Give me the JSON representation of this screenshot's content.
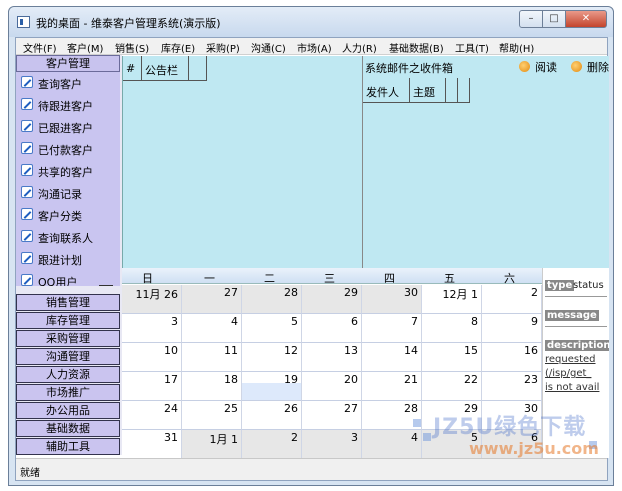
{
  "window": {
    "title": "我的桌面 - 维泰客户管理系统(演示版)"
  },
  "menu": [
    "文件(F)",
    "客户(M)",
    "销售(S)",
    "库存(E)",
    "采购(P)",
    "沟通(C)",
    "市场(A)",
    "人力(R)",
    "基础数据(B)",
    "工具(T)",
    "帮助(H)"
  ],
  "nav": {
    "header": "客户管理",
    "items": [
      "查询客户",
      "待跟进客户",
      "已跟进客户",
      "已付款客户",
      "共享的客户",
      "沟通记录",
      "客户分类",
      "查询联系人",
      "跟进计划",
      "QQ用户"
    ],
    "categories": [
      "销售管理",
      "库存管理",
      "采购管理",
      "沟通管理",
      "人力资源",
      "市场推广",
      "办公用品",
      "基础数据",
      "辅助工具"
    ]
  },
  "notice": {
    "col_hash": "#",
    "col_title": "公告栏"
  },
  "mail": {
    "title": "系统邮件之收件箱",
    "read": "阅读",
    "delete": "删除",
    "col_sender": "发件人",
    "col_subject": "主题"
  },
  "calendar": {
    "weekdays": [
      "日",
      "一",
      "二",
      "三",
      "四",
      "五",
      "六"
    ],
    "weeks": [
      [
        "11月 26",
        "27",
        "28",
        "29",
        "30",
        "12月 1",
        "2"
      ],
      [
        "3",
        "4",
        "5",
        "6",
        "7",
        "8",
        "9"
      ],
      [
        "10",
        "11",
        "12",
        "13",
        "14",
        "15",
        "16"
      ],
      [
        "17",
        "18",
        "19",
        "20",
        "21",
        "22",
        "23"
      ],
      [
        "24",
        "25",
        "26",
        "27",
        "28",
        "29",
        "30"
      ],
      [
        "31",
        "1月 1",
        "2",
        "3",
        "4",
        "5",
        "6"
      ]
    ]
  },
  "error": {
    "type_label": "type",
    "type_value": "status",
    "message_label": "message",
    "description_label": "description",
    "lines": [
      "requested",
      "(/isp/get_",
      "is not avail"
    ]
  },
  "status": {
    "text": "就绪"
  },
  "watermark": {
    "top": "JZ5U绿色下载",
    "bottom": "www.jz5u.com"
  }
}
